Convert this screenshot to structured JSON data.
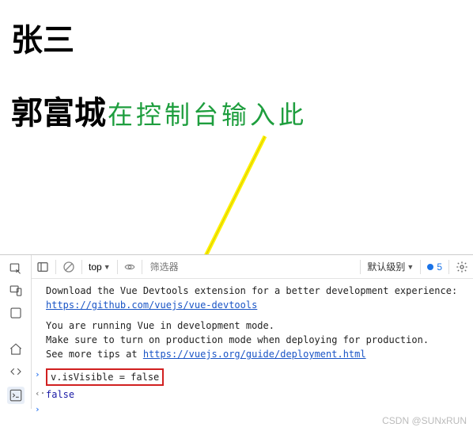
{
  "content": {
    "heading1": "张三",
    "heading2": "郭富城",
    "annotation": "在控制台输入此"
  },
  "toolbar": {
    "context": "top",
    "filter_placeholder": "筛选器",
    "level_label": "默认级别",
    "msg_count": "5"
  },
  "console": {
    "msg1_pre": "Download the Vue Devtools extension for a better development experience:",
    "msg1_link": "https://github.com/vuejs/vue-devtools",
    "msg2_line1": "You are running Vue in development mode.",
    "msg2_line2": "Make sure to turn on production mode when deploying for production.",
    "msg2_line3_pre": "See more tips at ",
    "msg2_link": "https://vuejs.org/guide/deployment.html",
    "input_line": "v.isVisible = false",
    "output_line": "false"
  },
  "watermark": "CSDN @SUNxRUN"
}
